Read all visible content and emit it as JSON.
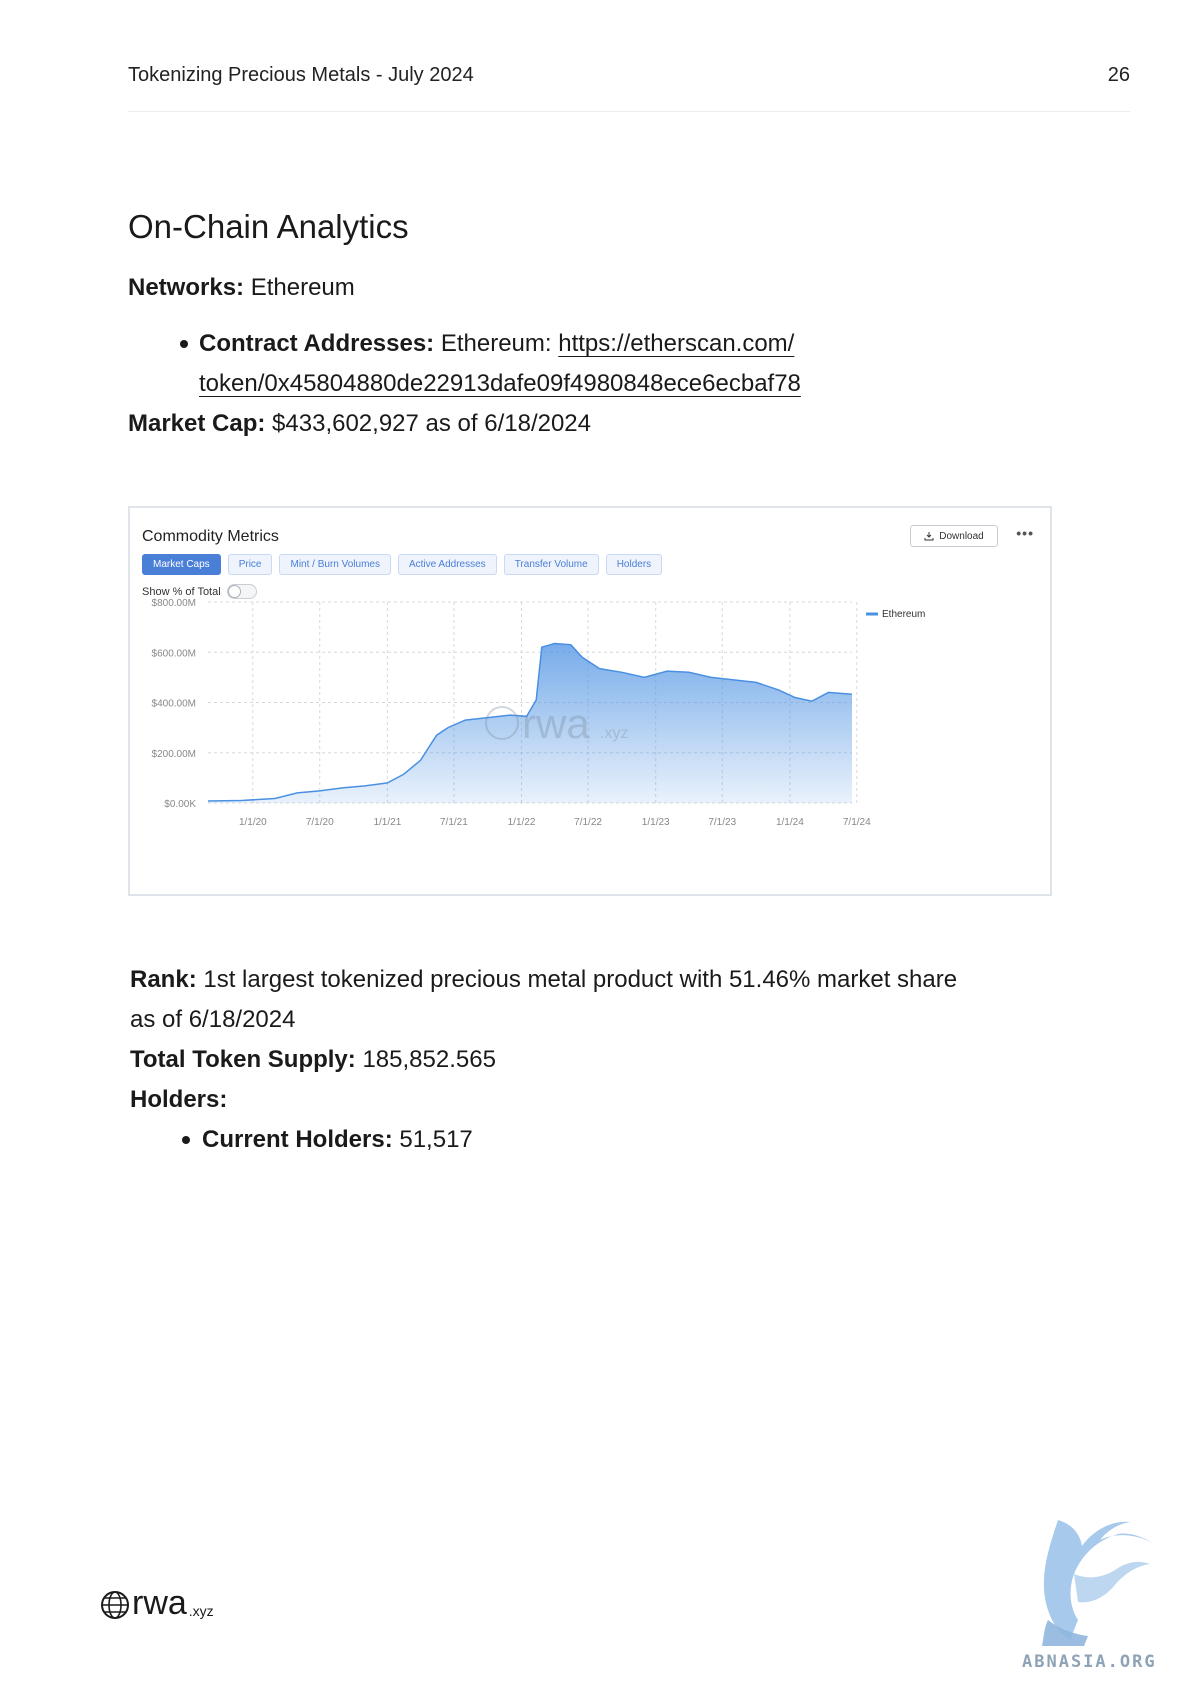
{
  "header": {
    "title": "Tokenizing Precious Metals - July 2024",
    "page_number": "26"
  },
  "section_title": "On-Chain Analytics",
  "networks": {
    "label": "Networks:",
    "value": "Ethereum"
  },
  "contract": {
    "label": "Contract Addresses:",
    "prefix": "Ethereum:",
    "url_line1": "https://etherscan.com/",
    "url_line2": "token/0x45804880de22913dafe09f4980848ece6ecbaf78"
  },
  "market_cap": {
    "label": "Market Cap:",
    "value": "$433,602,927 as of 6/18/2024"
  },
  "chart_card": {
    "title": "Commodity Metrics",
    "download_label": "Download",
    "more_label": "•••",
    "tabs": [
      "Market Caps",
      "Price",
      "Mint / Burn Volumes",
      "Active Addresses",
      "Transfer Volume",
      "Holders"
    ],
    "active_tab": 0,
    "toggle_label": "Show % of Total",
    "watermark_word": "rwa",
    "watermark_tld": ".xyz",
    "area_color": "#4a90e2"
  },
  "chart_data": {
    "type": "area",
    "title": "",
    "xlabel": "",
    "ylabel": "",
    "ylim": [
      0,
      800
    ],
    "y_unit": "$M",
    "y_ticks": [
      "$800.00M",
      "$600.00M",
      "$400.00M",
      "$200.00M",
      "$0.00K"
    ],
    "x_ticks": [
      "1/1/20",
      "7/1/20",
      "1/1/21",
      "7/1/21",
      "1/1/22",
      "7/1/22",
      "1/1/23",
      "7/1/23",
      "1/1/24",
      "7/1/24"
    ],
    "x_range": [
      "2019-09-01",
      "2024-06-18"
    ],
    "grid": true,
    "legend_position": "top-right",
    "series": [
      {
        "name": "Ethereum",
        "color": "#4a90e2",
        "points": [
          [
            "2019-09-01",
            8
          ],
          [
            "2019-12-01",
            10
          ],
          [
            "2020-03-01",
            18
          ],
          [
            "2020-05-01",
            40
          ],
          [
            "2020-07-01",
            48
          ],
          [
            "2020-09-01",
            60
          ],
          [
            "2020-11-01",
            68
          ],
          [
            "2021-01-01",
            80
          ],
          [
            "2021-02-15",
            115
          ],
          [
            "2021-04-01",
            170
          ],
          [
            "2021-05-15",
            270
          ],
          [
            "2021-06-15",
            300
          ],
          [
            "2021-08-01",
            330
          ],
          [
            "2021-10-01",
            340
          ],
          [
            "2021-12-01",
            350
          ],
          [
            "2022-01-15",
            345
          ],
          [
            "2022-02-10",
            410
          ],
          [
            "2022-02-25",
            620
          ],
          [
            "2022-04-01",
            635
          ],
          [
            "2022-05-15",
            630
          ],
          [
            "2022-06-15",
            580
          ],
          [
            "2022-08-01",
            535
          ],
          [
            "2022-10-01",
            520
          ],
          [
            "2022-12-01",
            500
          ],
          [
            "2023-02-01",
            525
          ],
          [
            "2023-04-01",
            520
          ],
          [
            "2023-06-01",
            500
          ],
          [
            "2023-08-01",
            490
          ],
          [
            "2023-10-01",
            480
          ],
          [
            "2023-12-01",
            450
          ],
          [
            "2024-01-15",
            420
          ],
          [
            "2024-03-01",
            405
          ],
          [
            "2024-04-15",
            440
          ],
          [
            "2024-06-18",
            433
          ]
        ]
      }
    ]
  },
  "rank": {
    "label": "Rank:",
    "value_line1": "1st largest tokenized precious metal product with 51.46% market share",
    "value_line2": "as of 6/18/2024"
  },
  "supply": {
    "label": "Total Token Supply:",
    "value": "185,852.565"
  },
  "holders": {
    "label": "Holders:",
    "current_label": "Current Holders:",
    "current_value": "51,517"
  },
  "footer": {
    "logo_word": "rwa",
    "logo_tld": ".xyz"
  },
  "watermark": {
    "text": "ABNASIA.ORG"
  }
}
